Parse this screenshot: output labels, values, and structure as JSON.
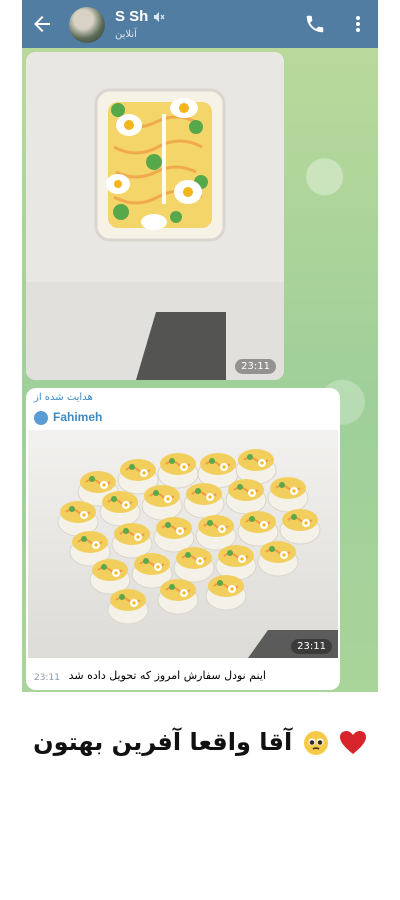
{
  "header": {
    "title": "S Sh",
    "status": "آنلاین",
    "icons": [
      "back-arrow-icon",
      "mute-icon",
      "phone-icon",
      "more-vert-icon"
    ]
  },
  "messages": [
    {
      "type": "photo",
      "time": "23:11"
    },
    {
      "type": "forwarded_photo",
      "forward_label": "هدایت شده از",
      "forward_from": "Fahimeh",
      "time": "23:11"
    },
    {
      "type": "text",
      "text": "اینم نودل سفارش امروز که تحویل داده شد",
      "time": "23:11"
    }
  ],
  "caption_below": "آقا واقعا آفرین بهتون",
  "colors": {
    "header": "#517da2",
    "accent": "#3d8ac4",
    "chat_bg": "#a7cf8f"
  }
}
